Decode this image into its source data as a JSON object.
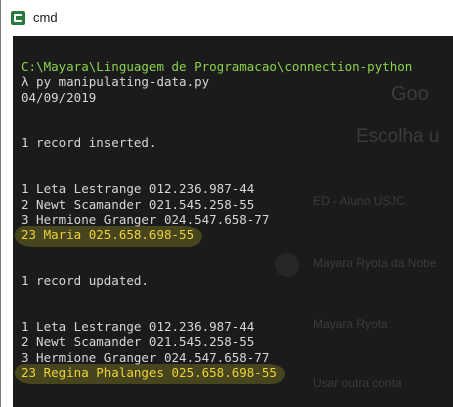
{
  "window": {
    "title": "cmd"
  },
  "background": {
    "heading_fragment": "Goo",
    "subheading_fragment": "Escolha u",
    "items": [
      {
        "label": "ED - Aluno USJC"
      },
      {
        "label": "Mayara Ryota da Nobe"
      },
      {
        "label": "Mayara Ryota"
      },
      {
        "label": "Usar outra conta"
      }
    ]
  },
  "console": {
    "lines": [
      {
        "text": "C:\\Mayara\\Linguagem de Programacao\\connection-python",
        "style": "path"
      },
      {
        "text": "λ py manipulating-data.py",
        "style": "plain"
      },
      {
        "text": "04/09/2019",
        "style": "plain"
      },
      {
        "text": "",
        "style": "plain"
      },
      {
        "text": "",
        "style": "plain"
      },
      {
        "text": "1 record inserted.",
        "style": "plain"
      },
      {
        "text": "",
        "style": "plain"
      },
      {
        "text": "",
        "style": "plain"
      },
      {
        "text": "1 Leta Lestrange 012.236.987-44",
        "style": "plain"
      },
      {
        "text": "2 Newt Scamander 021.545.258-55",
        "style": "plain"
      },
      {
        "text": "3 Hermione Granger 024.547.658-77",
        "style": "plain"
      },
      {
        "text": "23 Maria 025.658.698-55",
        "style": "highlight"
      },
      {
        "text": "",
        "style": "plain"
      },
      {
        "text": "",
        "style": "plain"
      },
      {
        "text": "1 record updated.",
        "style": "plain"
      },
      {
        "text": "",
        "style": "plain"
      },
      {
        "text": "",
        "style": "plain"
      },
      {
        "text": "1 Leta Lestrange 012.236.987-44",
        "style": "plain"
      },
      {
        "text": "2 Newt Scamander 021.545.258-55",
        "style": "plain"
      },
      {
        "text": "3 Hermione Granger 024.547.658-77",
        "style": "plain"
      },
      {
        "text": "23 Regina Phalanges 025.658.698-55",
        "style": "highlight"
      }
    ]
  },
  "colors": {
    "console_background": "#1b1b1b",
    "console_text": "#d6d6d6",
    "path_text": "#8ad34c",
    "highlight_text": "#ecd23a",
    "window_icon": "#2b7a3d"
  },
  "icons": {
    "app": "cmder-terminal-icon"
  }
}
